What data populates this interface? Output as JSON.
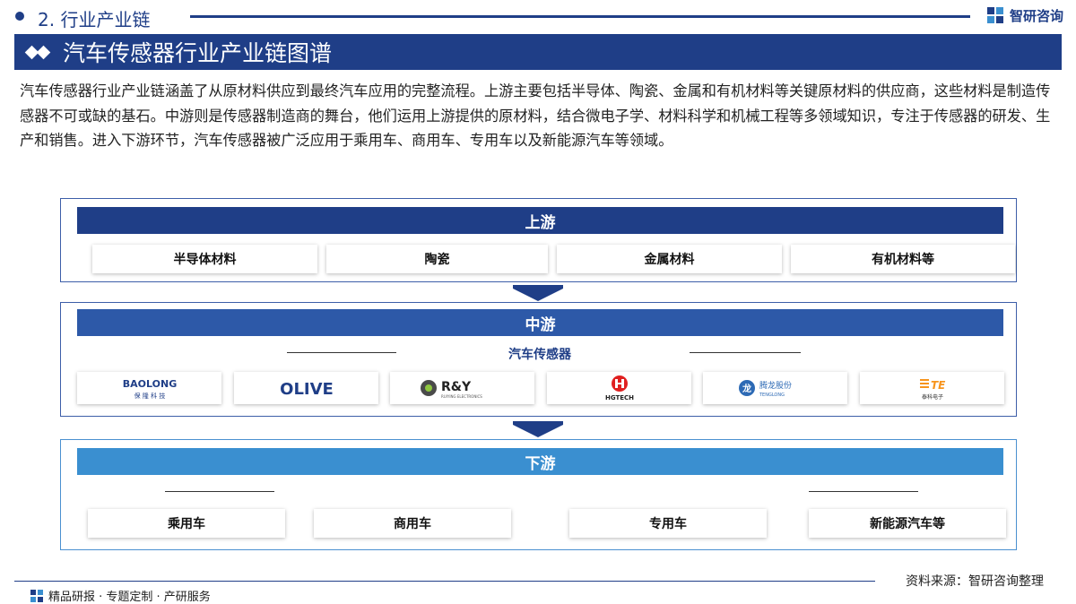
{
  "top": {
    "section": "2. 行业产业链",
    "brand": "智研咨询"
  },
  "title": "汽车传感器行业产业链图谱",
  "intro": "汽车传感器行业产业链涵盖了从原材料供应到最终汽车应用的完整流程。上游主要包括半导体、陶瓷、金属和有机材料等关键原材料的供应商，这些材料是制造传感器不可或缺的基石。中游则是传感器制造商的舞台，他们运用上游提供的原材料，结合微电子学、材料科学和机械工程等多领域知识，专注于传感器的研发、生产和销售。进入下游环节，汽车传感器被广泛应用于乘用车、商用车、专用车以及新能源汽车等领域。",
  "diagram": {
    "upstream": {
      "header": "上游",
      "items": [
        "半导体材料",
        "陶瓷",
        "金属材料",
        "有机材料等"
      ]
    },
    "midstream": {
      "header": "中游",
      "sub_label": "汽车传感器",
      "logos": [
        {
          "name": "baolong",
          "line1": "BAOLONG",
          "line2": "保 隆 科 技"
        },
        {
          "name": "olive",
          "line1": "OLIVE"
        },
        {
          "name": "ry",
          "line1": "R&Y",
          "line2": "RUIYING ELECTRONICS"
        },
        {
          "name": "hgtech",
          "line1": "HGTECH"
        },
        {
          "name": "tenglong",
          "line1": "腾龙股份",
          "line2": "TENGLONG"
        },
        {
          "name": "te",
          "line1": "TE",
          "line2": "泰科电子"
        }
      ]
    },
    "downstream": {
      "header": "下游",
      "items": [
        "乘用车",
        "商用车",
        "专用车",
        "新能源汽车等"
      ]
    }
  },
  "colors": {
    "navy": "#1f3e87",
    "mid_blue": "#2d59a8",
    "light_blue": "#3a8fd0"
  },
  "source": "资料来源：智研咨询整理",
  "footer": "精品研报 · 专题定制 · 产研服务"
}
